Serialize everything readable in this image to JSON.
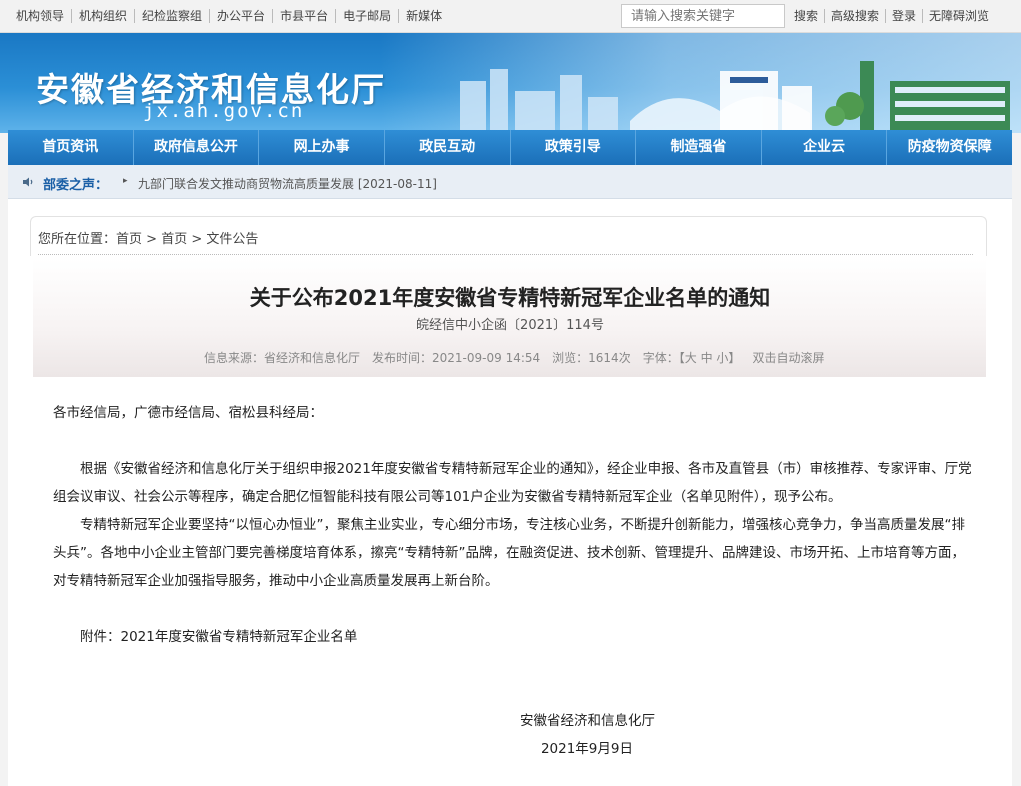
{
  "topbar": {
    "links": [
      "机构领导",
      "机构组织",
      "纪检监察组",
      "办公平台",
      "市县平台",
      "电子邮局",
      "新媒体"
    ],
    "search_placeholder": "请输入搜索关键字",
    "right_links": [
      "搜索",
      "高级搜索",
      "登录",
      "无障碍浏览"
    ]
  },
  "banner": {
    "title": "安徽省经济和信息化厅",
    "domain": "jx.ah.gov.cn"
  },
  "nav": [
    "首页资讯",
    "政府信息公开",
    "网上办事",
    "政民互动",
    "政策引导",
    "制造强省",
    "企业云",
    "防疫物资保障"
  ],
  "notice": {
    "label": "部委之声：",
    "text": "九部门联合发文推动商贸物流高质量发展 [2021-08-11]"
  },
  "breadcrumb": {
    "prefix": "您所在位置：",
    "items": [
      "首页",
      "首页",
      "文件公告"
    ]
  },
  "article": {
    "title": "关于公布2021年度安徽省专精特新冠军企业名单的通知",
    "doc_no": "皖经信中小企函〔2021〕114号",
    "meta": {
      "source": "信息来源：省经济和信息化厅",
      "time": "发布时间：2021-09-09 14:54",
      "views": "浏览：1614次",
      "font_label": "字体：【",
      "font_big": "大",
      "font_mid": "中",
      "font_small": "小",
      "font_end": "】",
      "autoscroll": "双击自动滚屏"
    },
    "salutation": "各市经信局，广德市经信局、宿松县科经局：",
    "para1": "根据《安徽省经济和信息化厅关于组织申报2021年度安徽省专精特新冠军企业的通知》，经企业申报、各市及直管县（市）审核推荐、专家评审、厅党组会议审议、社会公示等程序，确定合肥亿恒智能科技有限公司等101户企业为安徽省专精特新冠军企业（名单见附件），现予公布。",
    "para2": "专精特新冠军企业要坚持“以恒心办恒业”，聚焦主业实业，专心细分市场，专注核心业务，不断提升创新能力，增强核心竞争力，争当高质量发展“排头兵”。各地中小企业主管部门要完善梯度培育体系，擦亮“专精特新”品牌，在融资促进、技术创新、管理提升、品牌建设、市场开拓、上市培育等方面，对专精特新冠军企业加强指导服务，推动中小企业高质量发展再上新台阶。",
    "attachment": "附件：2021年度安徽省专精特新冠军企业名单",
    "signature": "安徽省经济和信息化厅",
    "date": "2021年9月9日"
  },
  "colors": {
    "nav_blue": "#1b6fb8",
    "banner_blue": "#2b8fd6",
    "notice_label": "#1a5fa6"
  }
}
